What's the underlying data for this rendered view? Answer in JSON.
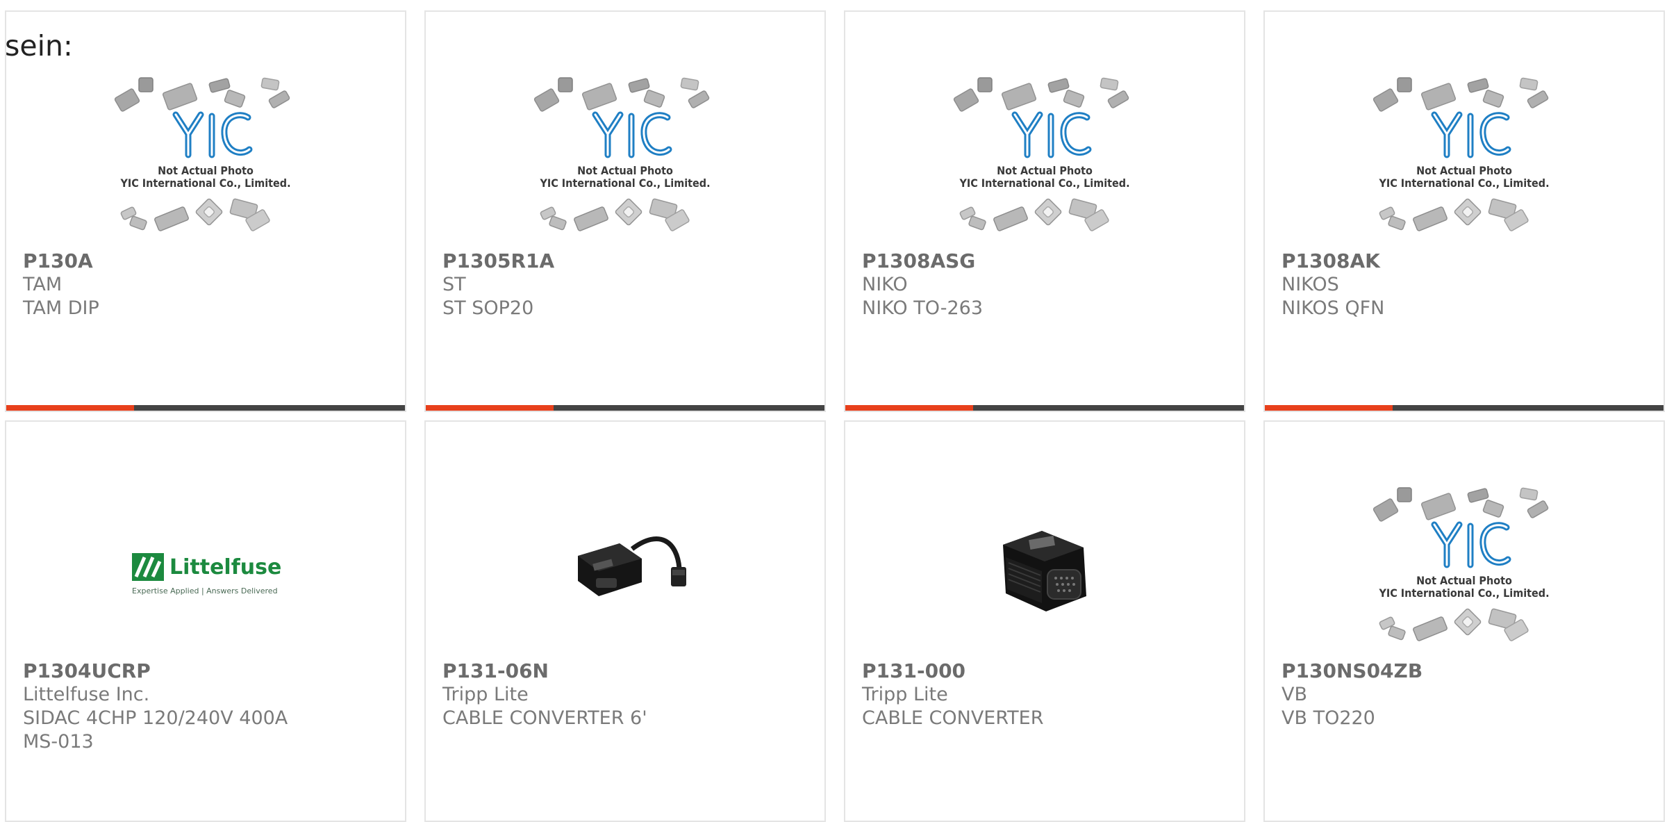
{
  "page": {
    "fragment_text": "sein:"
  },
  "placeholder_image": {
    "line1": "Not Actual Photo",
    "line2": "YIC International Co., Limited.",
    "logo": "YIC"
  },
  "littelfuse_logo": {
    "name": "Littelfuse",
    "tagline": "Expertise Applied | Answers Delivered"
  },
  "colors": {
    "accent": "#e8401c",
    "bar": "#444444",
    "border": "#e4e4e4",
    "yic_blue": "#1f7fc4",
    "littelfuse_green": "#1c8a3f"
  },
  "products": [
    {
      "part": "P130A",
      "manufacturer": "TAM",
      "description": "TAM DIP",
      "image": "yic-placeholder"
    },
    {
      "part": "P1305R1A",
      "manufacturer": "ST",
      "description": "ST SOP20",
      "image": "yic-placeholder"
    },
    {
      "part": "P1308ASG",
      "manufacturer": "NIKO",
      "description": "NIKO TO-263",
      "image": "yic-placeholder"
    },
    {
      "part": "P1308AK",
      "manufacturer": "NIKOS",
      "description": "NIKOS QFN",
      "image": "yic-placeholder"
    },
    {
      "part": "P1304UCRP",
      "manufacturer": "Littelfuse Inc.",
      "description": "SIDAC 4CHP 120/240V 400A MS-013",
      "image": "littelfuse-logo"
    },
    {
      "part": "P131-06N",
      "manufacturer": "Tripp Lite",
      "description": "CABLE CONVERTER 6'",
      "image": "vga-cable-adapter"
    },
    {
      "part": "P131-000",
      "manufacturer": "Tripp Lite",
      "description": "CABLE CONVERTER",
      "image": "vga-dongle"
    },
    {
      "part": "P130NS04ZB",
      "manufacturer": "VB",
      "description": "VB TO220",
      "image": "yic-placeholder"
    }
  ]
}
